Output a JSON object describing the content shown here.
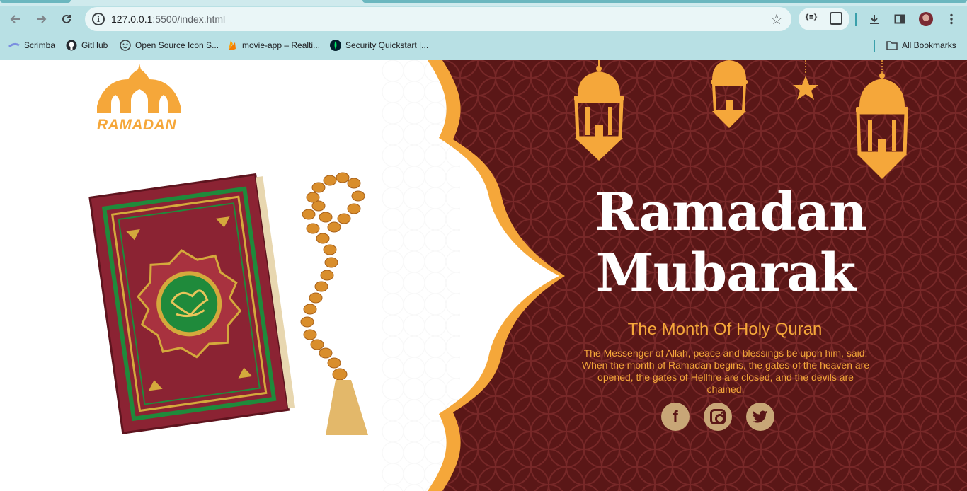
{
  "browser": {
    "url_host": "127.0.0.1",
    "url_path": ":5500/index.html",
    "extension_label": "{≡}",
    "bookmarks": [
      {
        "label": "Scrimba",
        "icon": "scrimba-icon"
      },
      {
        "label": "GitHub",
        "icon": "github-icon"
      },
      {
        "label": "Open Source Icon S...",
        "icon": "smiley-icon"
      },
      {
        "label": "movie-app – Realti...",
        "icon": "firebase-icon"
      },
      {
        "label": "Security Quickstart |...",
        "icon": "mongodb-icon"
      }
    ],
    "all_bookmarks": "All Bookmarks"
  },
  "page": {
    "logo_text": "RAMADAN",
    "title_line1": "Ramadan",
    "title_line2": "Mubarak",
    "subtitle": "The Month Of Holy Quran",
    "description": "The Messenger of Allah, peace and blessings be upon him, said: When the month of Ramadan begins, the gates of the heaven are opened, the gates of Hellfire are closed, and the devils are chained.",
    "socials": [
      {
        "name": "facebook",
        "glyph": "f"
      },
      {
        "name": "instagram",
        "glyph": ""
      },
      {
        "name": "twitter",
        "glyph": "🐦"
      }
    ]
  },
  "colors": {
    "accent": "#f5a73a",
    "maroon": "#5a1717",
    "social_bg": "#c8a677",
    "chrome": "#b8e0e4"
  }
}
